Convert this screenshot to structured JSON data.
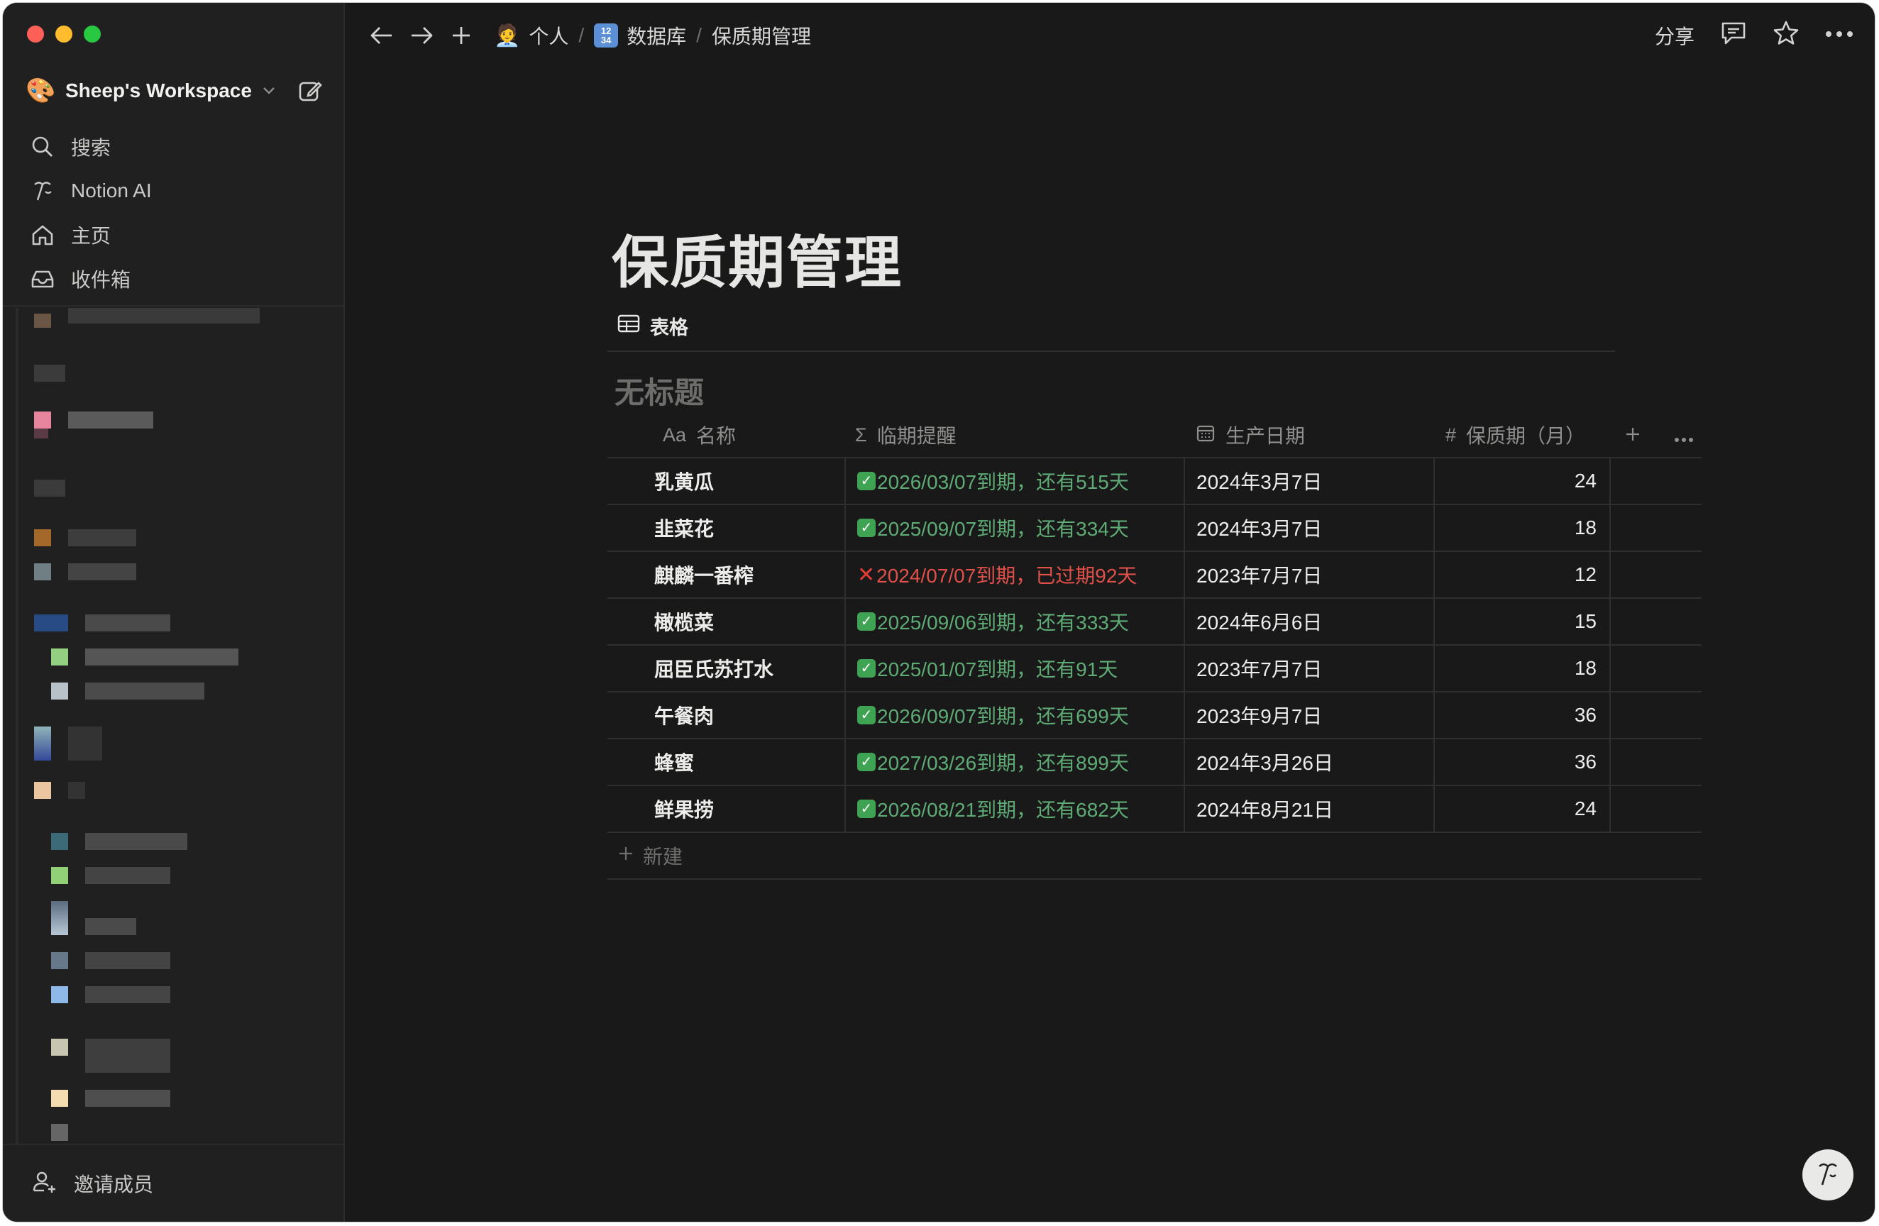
{
  "sidebar": {
    "workspace_name": "Sheep's Workspace",
    "workspace_icon": "palette-emoji",
    "nav": [
      {
        "label": "搜索",
        "icon": "search-icon"
      },
      {
        "label": "Notion AI",
        "icon": "notion-ai-icon"
      },
      {
        "label": "主页",
        "icon": "home-icon"
      },
      {
        "label": "收件箱",
        "icon": "inbox-icon"
      }
    ],
    "invite_label": "邀请成员"
  },
  "topbar": {
    "breadcrumbs": [
      {
        "label": "个人",
        "icon": "person-emoji"
      },
      {
        "label": "数据库",
        "icon": "numbers-emoji"
      },
      {
        "label": "保质期管理"
      }
    ],
    "share_label": "分享"
  },
  "page": {
    "title": "保质期管理",
    "view_tab_label": "表格",
    "db_title": "无标题"
  },
  "table": {
    "headers": {
      "name": {
        "prefix": "Aa",
        "label": "名称"
      },
      "remind": {
        "prefix": "Σ",
        "label": "临期提醒"
      },
      "date": {
        "label": "生产日期"
      },
      "shelf": {
        "prefix": "#",
        "label": "保质期（月）"
      }
    },
    "rows": [
      {
        "name": "乳黄瓜",
        "remind": "2026/03/07到期，还有515天",
        "status": "ok",
        "date": "2024年3月7日",
        "shelf": "24"
      },
      {
        "name": "韭菜花",
        "remind": "2025/09/07到期，还有334天",
        "status": "ok",
        "date": "2024年3月7日",
        "shelf": "18"
      },
      {
        "name": "麒麟一番榨",
        "remind": "2024/07/07到期，已过期92天",
        "status": "expired",
        "date": "2023年7月7日",
        "shelf": "12"
      },
      {
        "name": "橄榄菜",
        "remind": "2025/09/06到期，还有333天",
        "status": "ok",
        "date": "2024年6月6日",
        "shelf": "15"
      },
      {
        "name": "屈臣氏苏打水",
        "remind": "2025/01/07到期，还有91天",
        "status": "ok",
        "date": "2023年7月7日",
        "shelf": "18"
      },
      {
        "name": "午餐肉",
        "remind": "2026/09/07到期，还有699天",
        "status": "ok",
        "date": "2023年9月7日",
        "shelf": "36"
      },
      {
        "name": "蜂蜜",
        "remind": "2027/03/26到期，还有899天",
        "status": "ok",
        "date": "2024年3月26日",
        "shelf": "36"
      },
      {
        "name": "鲜果捞",
        "remind": "2026/08/21到期，还有682天",
        "status": "ok",
        "date": "2024年8月21日",
        "shelf": "24"
      }
    ],
    "new_row_label": "新建"
  },
  "colors": {
    "background": "#191919",
    "sidebar": "#202020",
    "ok_text": "#5fab75",
    "expired_text": "#e0504a"
  }
}
